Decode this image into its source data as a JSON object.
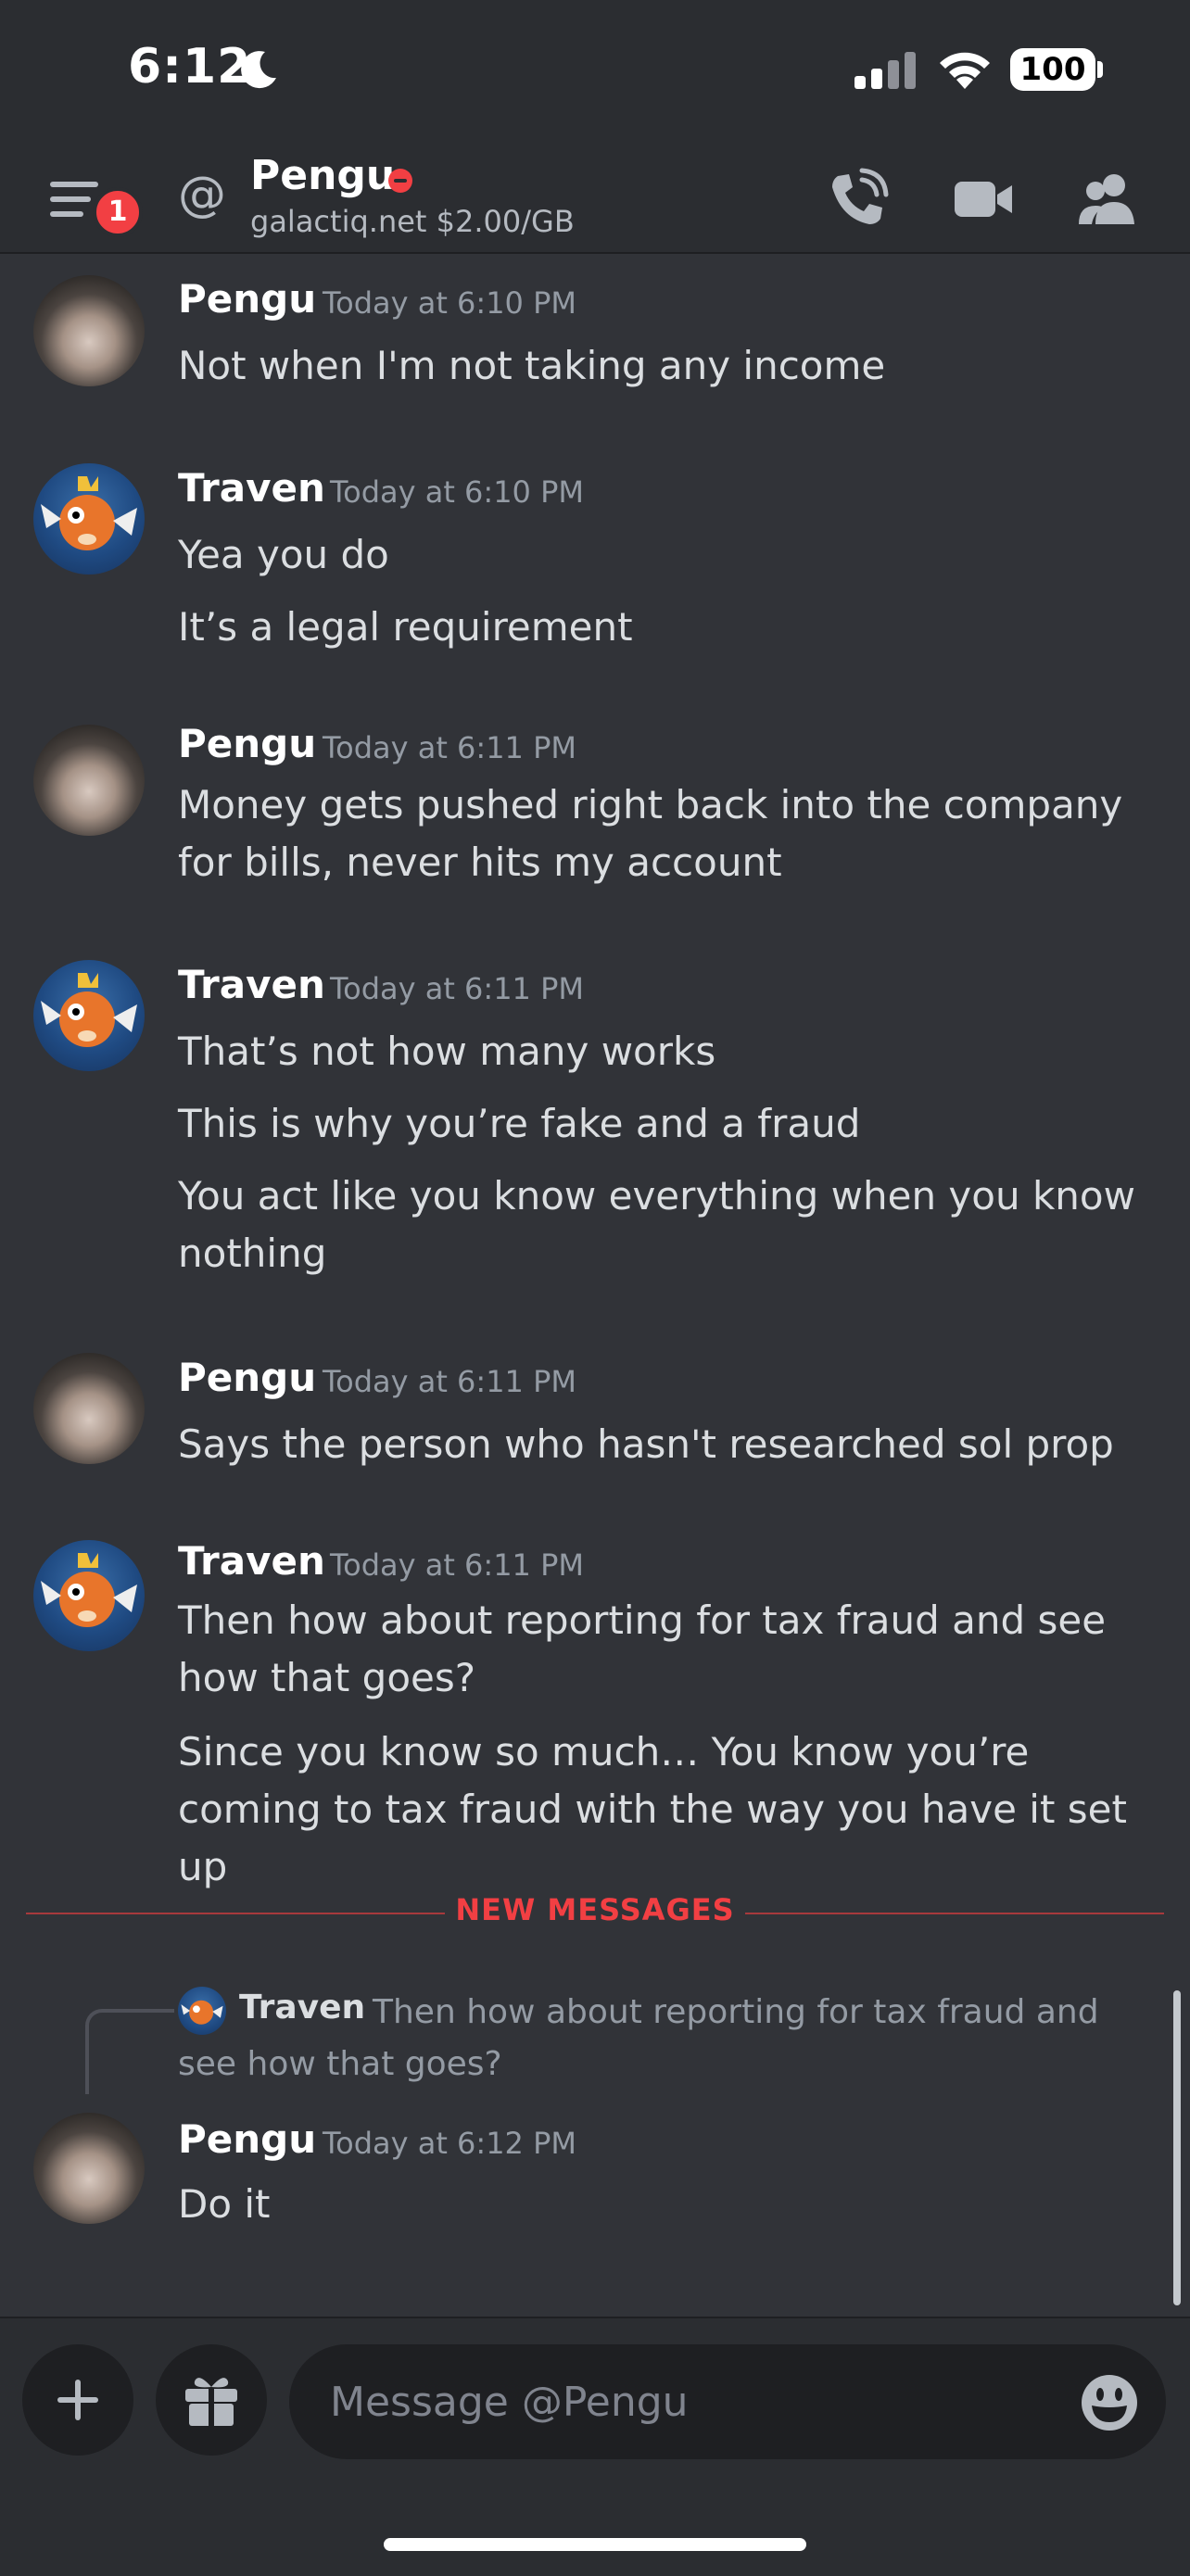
{
  "status_bar": {
    "time": "6:12",
    "battery": "100"
  },
  "header": {
    "unread_badge": "1",
    "channel_name": "Pengu",
    "channel_status": "galactiq.net $2.00/GB",
    "icons": [
      "menu-icon",
      "at-icon",
      "call-icon",
      "video-icon",
      "members-icon"
    ]
  },
  "messages": [
    {
      "author": "Pengu",
      "time": "Today at 6:10 PM",
      "lines": [
        "Not when I'm not taking any income"
      ]
    },
    {
      "author": "Traven",
      "time": "Today at 6:10 PM",
      "lines": [
        "Yea you do",
        "It’s a legal requirement"
      ]
    },
    {
      "author": "Pengu",
      "time": "Today at 6:11 PM",
      "lines": [
        "Money gets pushed right back into the company for bills, never hits my account"
      ]
    },
    {
      "author": "Traven",
      "time": "Today at 6:11 PM",
      "lines": [
        "That’s not how many works",
        "This is why you’re fake and a fraud",
        "You act like you know everything when you know nothing"
      ]
    },
    {
      "author": "Pengu",
      "time": "Today at 6:11 PM",
      "lines": [
        "Says the person who hasn't researched sol prop"
      ]
    },
    {
      "author": "Traven",
      "time": "Today at 6:11 PM",
      "lines": [
        "Then how about reporting for tax fraud and see how that goes?",
        "Since you know so much… You know you’re coming to tax fraud with the way you have it set up"
      ]
    }
  ],
  "new_messages_label": "NEW MESSAGES",
  "reply": {
    "quoted_author": "Traven",
    "quoted_text": "Then how about reporting for tax fraud and see how that goes?",
    "author": "Pengu",
    "time": "Today at 6:12 PM",
    "text": "Do it"
  },
  "composer": {
    "placeholder": "Message @Pengu",
    "icons": [
      "plus-icon",
      "gift-icon",
      "emoji-icon"
    ]
  },
  "colors": {
    "background": "#313338",
    "header": "#2b2d31",
    "new_messages": "#f23f43",
    "badge": "#f23f43"
  }
}
